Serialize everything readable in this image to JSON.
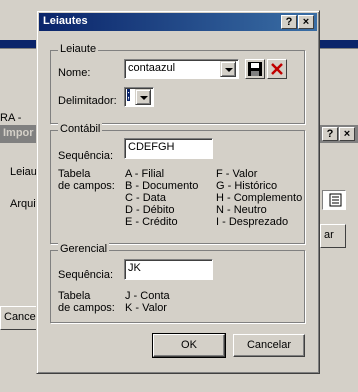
{
  "background": {
    "label_ra": "RA -",
    "inner_title": "Impor",
    "label_leiaute": "Leiau",
    "label_arquivo": "Arquiv",
    "button_ar": "ar",
    "button_cancel": "Cancel",
    "title_buttons": [
      "?",
      "×"
    ]
  },
  "dialog": {
    "title": "Leiautes",
    "title_buttons": {
      "help": "?",
      "close": "×"
    },
    "leiaute": {
      "legend": "Leiaute",
      "nome_label": "Nome:",
      "nome_value": "contaazul",
      "delimitador_label": "Delimitador:",
      "delimitador_value": ";"
    },
    "contabil": {
      "legend": "Contábil",
      "sequencia_label": "Sequência:",
      "sequencia_value": "CDEFGH",
      "tabela_label_1": "Tabela",
      "tabela_label_2": "de campos:",
      "campos_col1": [
        "A - Filial",
        "B - Documento",
        "C - Data",
        "D - Débito",
        "E - Crédito"
      ],
      "campos_col2": [
        "F - Valor",
        "G - Histórico",
        "H - Complemento",
        "N - Neutro",
        "I - Desprezado"
      ]
    },
    "gerencial": {
      "legend": "Gerencial",
      "sequencia_label": "Sequência:",
      "sequencia_value": "JK",
      "tabela_label_1": "Tabela",
      "tabela_label_2": "de campos:",
      "campos": [
        "J - Conta",
        "K - Valor"
      ]
    },
    "buttons": {
      "ok": "OK",
      "cancel": "Cancelar"
    }
  }
}
